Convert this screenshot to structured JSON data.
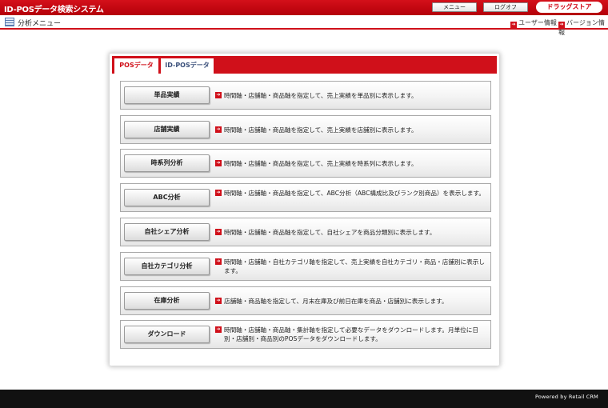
{
  "header": {
    "app_title": "ID-POSデータ検索システム",
    "menu_label": "メニュー",
    "logout_label": "ログオフ",
    "store_label": "ドラッグストア"
  },
  "subheader": {
    "page_title": "分析メニュー",
    "user_info_label": "ユーザー情報",
    "version_info_label": "バージョン情報"
  },
  "tabs": [
    {
      "label": "POSデータ",
      "active": true
    },
    {
      "label": "ID-POSデータ",
      "active": false
    }
  ],
  "rows": [
    {
      "button": "単品実績",
      "desc": "時間軸・店舗軸・商品軸を指定して、売上実績を単品別に表示します。"
    },
    {
      "button": "店舗実績",
      "desc": "時間軸・店舗軸・商品軸を指定して、売上実績を店舗別に表示します。"
    },
    {
      "button": "時系列分析",
      "desc": "時間軸・店舗軸・商品軸を指定して、売上実績を時系列に表示します。"
    },
    {
      "button": "ABC分析",
      "desc": "時間軸・店舗軸・商品軸を指定して、ABC分析（ABC構成比及びランク別商品）を表示します。"
    },
    {
      "button": "自社シェア分析",
      "desc": "時間軸・店舗軸・商品軸を指定して、自社シェアを商品分類別に表示します。"
    },
    {
      "button": "自社カテゴリ分析",
      "desc": "時間軸・店舗軸・自社カテゴリ軸を指定して、売上実績を自社カテゴリ・商品・店舗別に表示します。"
    },
    {
      "button": "在庫分析",
      "desc": "店舗軸・商品軸を指定して、月末在庫及び前日在庫を商品・店舗別に表示します。"
    },
    {
      "button": "ダウンロード",
      "desc": "時間軸・店舗軸・商品軸・集計軸を指定して必要なデータをダウンロードします。月単位に日別・店舗別・商品別のPOSデータをダウンロードします。"
    }
  ],
  "footer": {
    "powered_by": "Powered by Retail CRM"
  },
  "colors": {
    "brand_red": "#d0101a",
    "footer_bg": "#111111"
  }
}
